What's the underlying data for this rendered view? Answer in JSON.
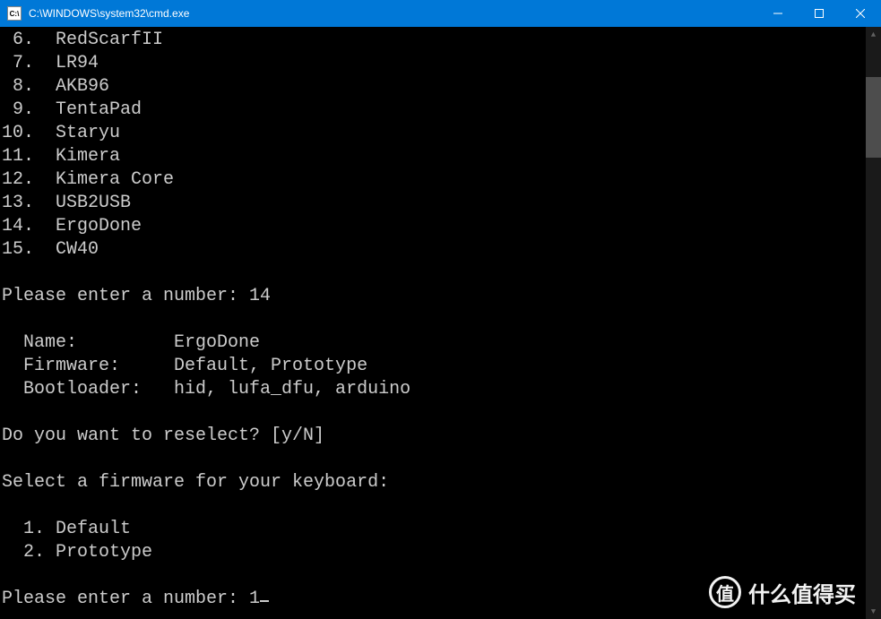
{
  "window": {
    "icon_text": "C:\\",
    "title": "C:\\WINDOWS\\system32\\cmd.exe"
  },
  "terminal": {
    "list": [
      {
        "num": " 6",
        "label": "RedScarfII"
      },
      {
        "num": " 7",
        "label": "LR94"
      },
      {
        "num": " 8",
        "label": "AKB96"
      },
      {
        "num": " 9",
        "label": "TentaPad"
      },
      {
        "num": "10",
        "label": "Staryu"
      },
      {
        "num": "11",
        "label": "Kimera"
      },
      {
        "num": "12",
        "label": "Kimera Core"
      },
      {
        "num": "13",
        "label": "USB2USB"
      },
      {
        "num": "14",
        "label": "ErgoDone"
      },
      {
        "num": "15",
        "label": "CW40"
      }
    ],
    "prompt1_label": "Please enter a number: ",
    "prompt1_value": "14",
    "info": {
      "name_label": "  Name:         ",
      "name_value": "ErgoDone",
      "fw_label": "  Firmware:     ",
      "fw_value": "Default, Prototype",
      "bl_label": "  Bootloader:   ",
      "bl_value": "hid, lufa_dfu, arduino"
    },
    "reselect": "Do you want to reselect? [y/N]",
    "select_fw": "Select a firmware for your keyboard:",
    "fw_options": [
      {
        "num": "  1",
        "label": "Default"
      },
      {
        "num": "  2",
        "label": "Prototype"
      }
    ],
    "prompt2_label": "Please enter a number: ",
    "prompt2_value": "1"
  },
  "watermark": {
    "badge": "值",
    "text": "什么值得买"
  }
}
